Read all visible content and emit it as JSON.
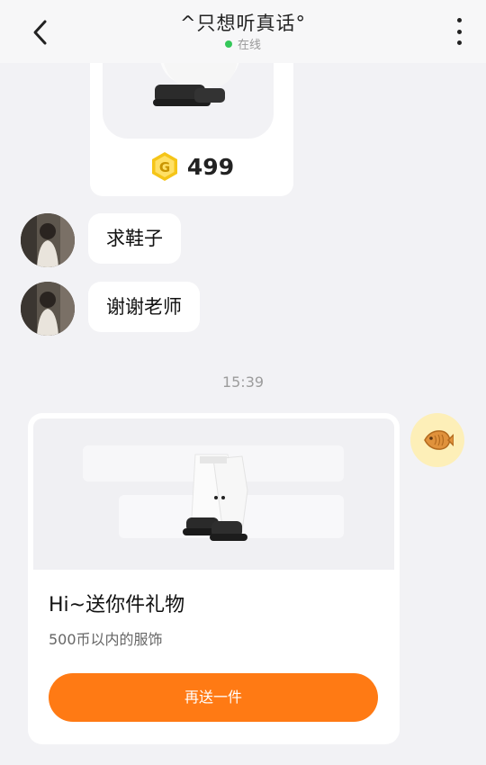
{
  "header": {
    "title": "^只想听真话°",
    "status": "在线"
  },
  "top_card": {
    "price": "499",
    "coin_letter": "G"
  },
  "messages": [
    {
      "text": "求鞋子"
    },
    {
      "text": "谢谢老师"
    }
  ],
  "time_divider": "15:39",
  "gift_card": {
    "title": "Hi~送你件礼物",
    "subtitle": "500币以内的服饰",
    "button_label": "再送一件"
  },
  "colors": {
    "accent": "#ff7a14",
    "online": "#34c759",
    "coin": "#f5c518",
    "fish_button_bg": "#fdefb8"
  }
}
